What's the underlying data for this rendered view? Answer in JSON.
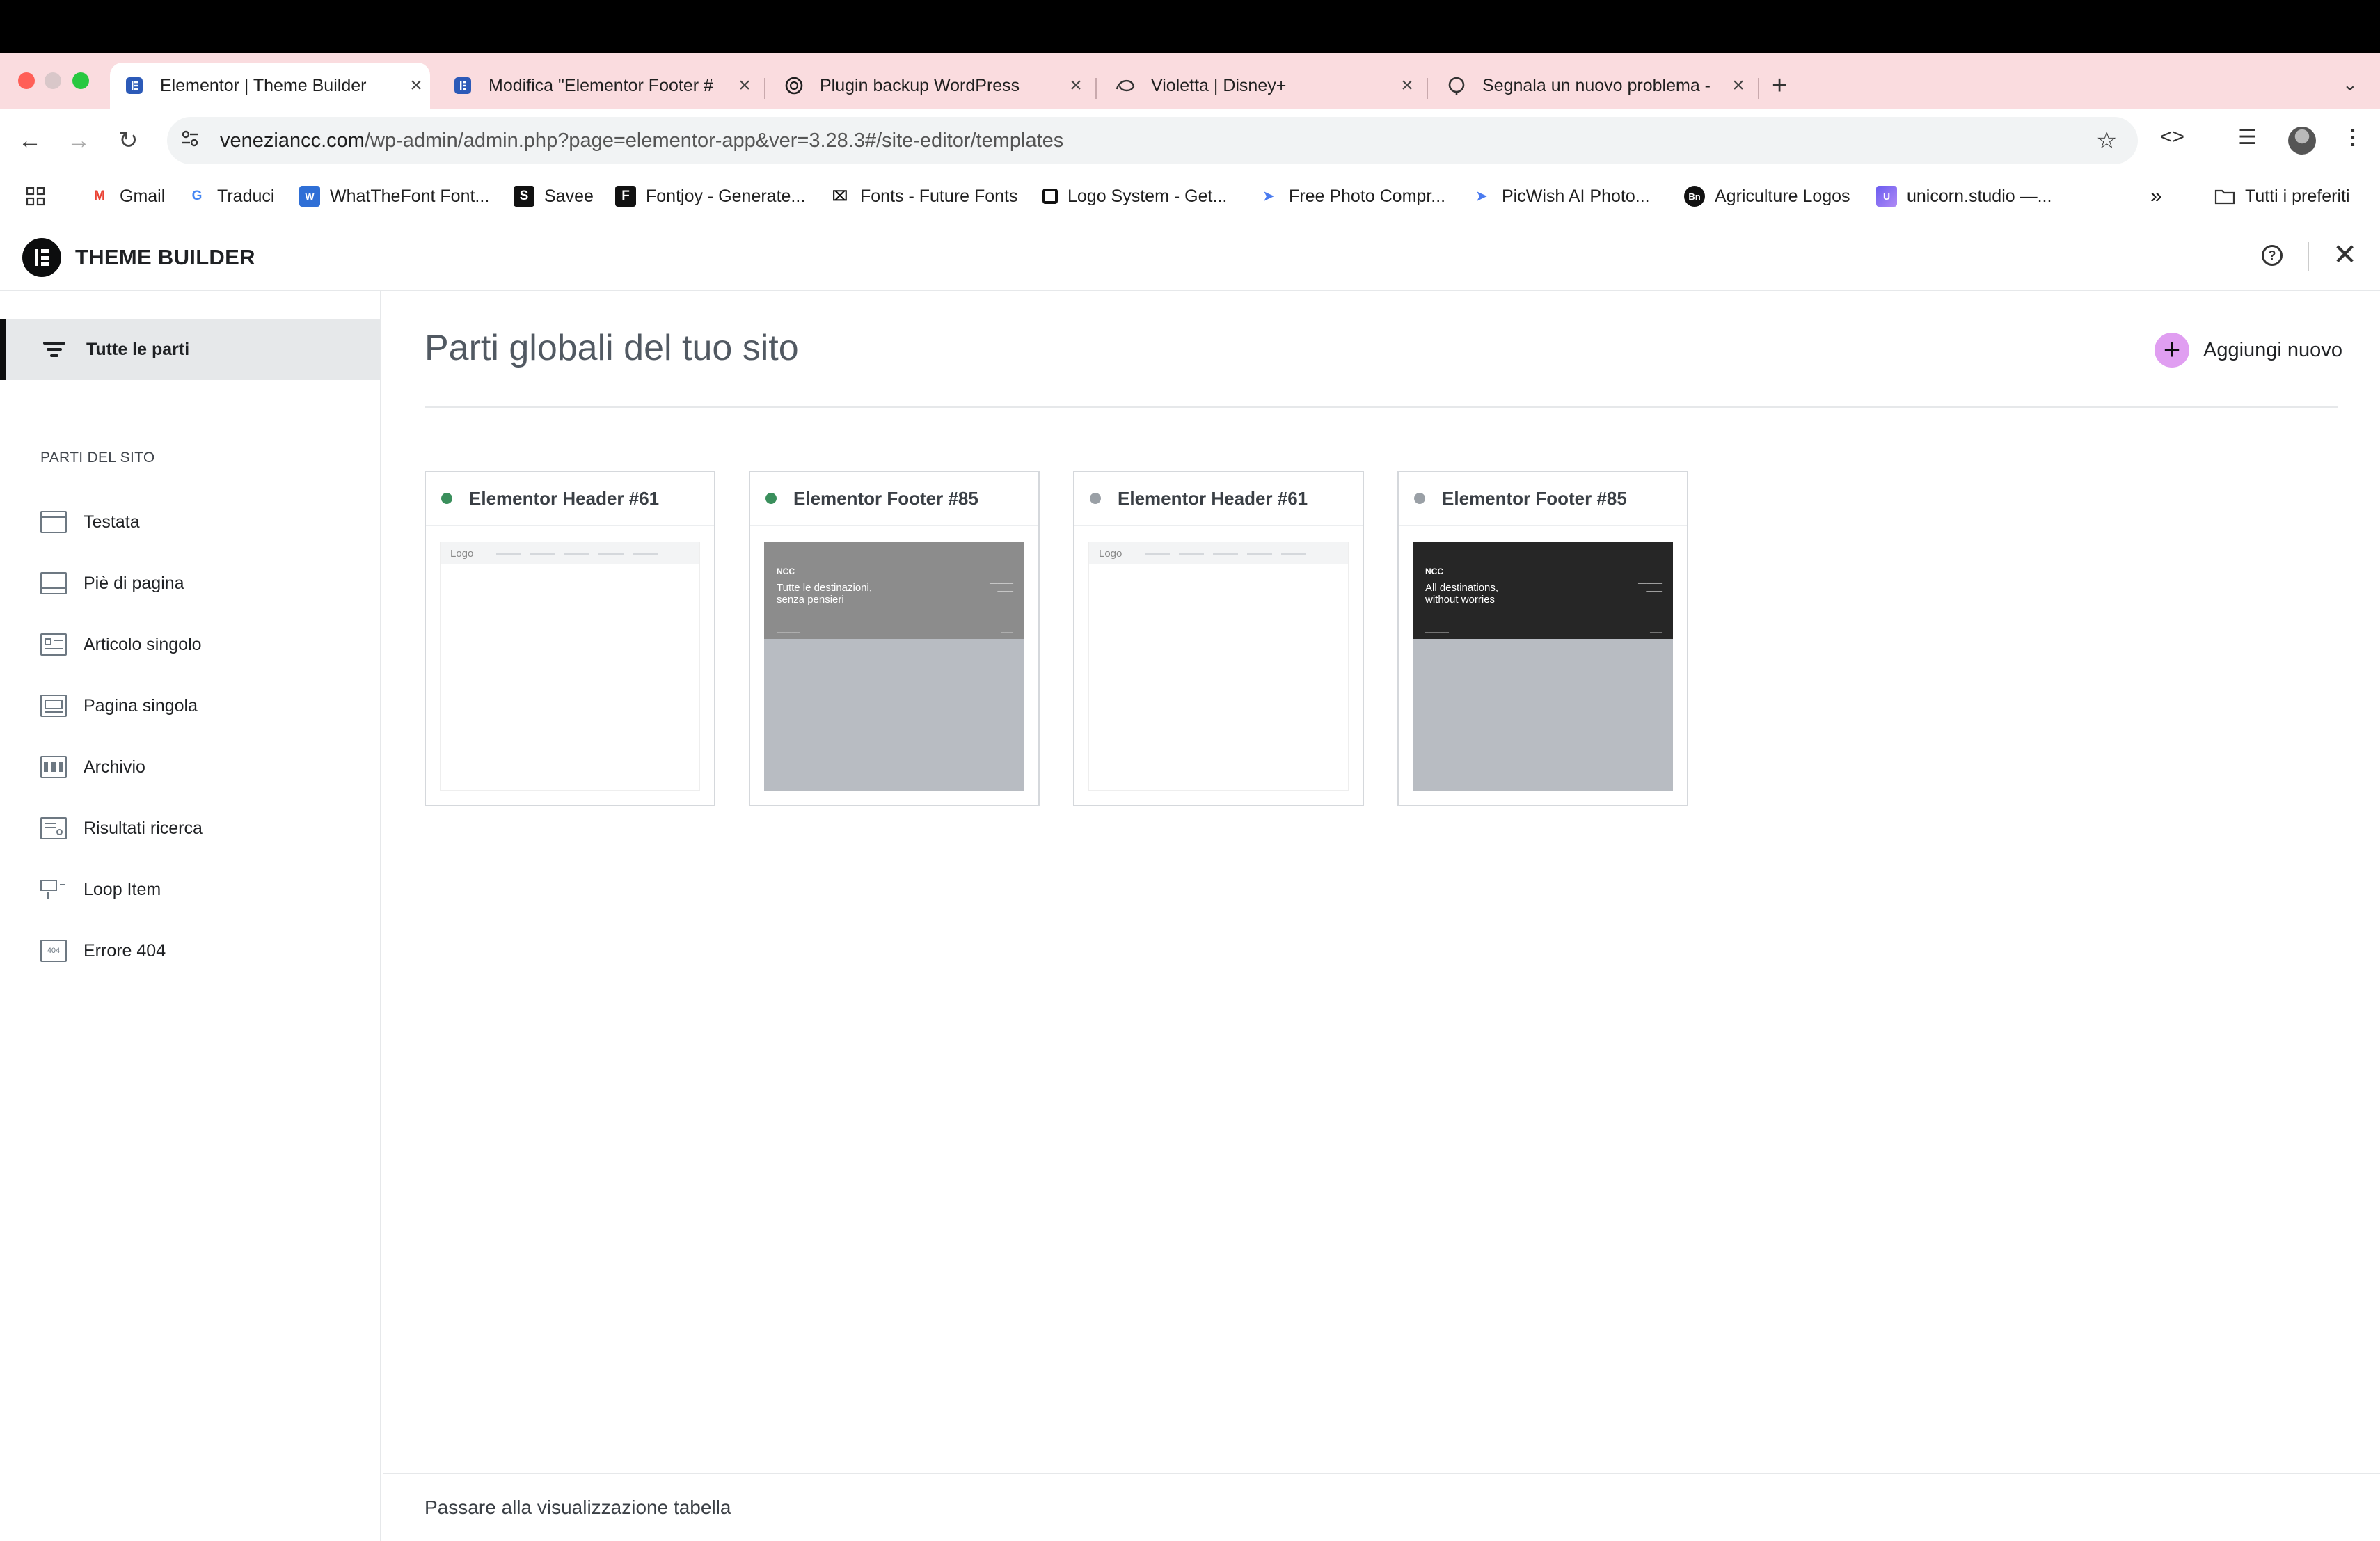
{
  "browser": {
    "tabs": [
      {
        "title": "Elementor | Theme Builder",
        "active": true,
        "icon": "elementor-icon"
      },
      {
        "title": "Modifica \"Elementor Footer #",
        "active": false,
        "icon": "elementor-icon"
      },
      {
        "title": "Plugin backup WordPress",
        "active": false,
        "icon": "openai-icon"
      },
      {
        "title": "Violetta | Disney+",
        "active": false,
        "icon": "disney-plus-icon"
      },
      {
        "title": "Segnala un nuovo problema -",
        "active": false,
        "icon": "support-icon"
      }
    ],
    "close_glyph": "×",
    "url_domain": "veneziancc.com",
    "url_path": "/wp-admin/admin.php?page=elementor-app&ver=3.28.3#/site-editor/templates",
    "bookmarks": [
      {
        "label": "Gmail",
        "icon": "gmail-icon"
      },
      {
        "label": "Traduci",
        "icon": "translate-icon"
      },
      {
        "label": "WhatTheFont Font...",
        "icon": "whatthefont-icon"
      },
      {
        "label": "Savee",
        "icon": "savee-icon"
      },
      {
        "label": "Fontjoy - Generate...",
        "icon": "fontjoy-icon"
      },
      {
        "label": "Fonts - Future Fonts",
        "icon": "futurefonts-icon"
      },
      {
        "label": "Logo System - Get...",
        "icon": "logosystem-icon"
      },
      {
        "label": "Free Photo Compr...",
        "icon": "photo-compressor-icon"
      },
      {
        "label": "PicWish AI Photo...",
        "icon": "picwish-icon"
      },
      {
        "label": "Agriculture Logos",
        "icon": "agriculture-logos-icon"
      },
      {
        "label": "unicorn.studio —...",
        "icon": "unicorn-studio-icon"
      }
    ],
    "bookmarks_overflow": "»",
    "all_bookmarks": "Tutti i preferiti"
  },
  "app": {
    "title": "THEME BUILDER"
  },
  "sidebar": {
    "all_parts": "Tutte le parti",
    "heading": "PARTI DEL SITO",
    "items": [
      {
        "label": "Testata",
        "icon": "header-layout-icon"
      },
      {
        "label": "Piè di pagina",
        "icon": "footer-layout-icon"
      },
      {
        "label": "Articolo singolo",
        "icon": "single-post-icon"
      },
      {
        "label": "Pagina singola",
        "icon": "single-page-icon"
      },
      {
        "label": "Archivio",
        "icon": "archive-icon"
      },
      {
        "label": "Risultati ricerca",
        "icon": "search-results-icon"
      },
      {
        "label": "Loop Item",
        "icon": "loop-item-icon"
      },
      {
        "label": "Errore 404",
        "icon": "error-404-icon"
      }
    ]
  },
  "main": {
    "title": "Parti globali del tuo sito",
    "add_new": "Aggiungi nuovo",
    "cards": [
      {
        "title": "Elementor Header #61",
        "status": "active",
        "kind": "header",
        "thumb_logo": "Logo"
      },
      {
        "title": "Elementor Footer #85",
        "status": "active",
        "kind": "footer",
        "thumb_badge": "NCC",
        "thumb_tagline_1": "Tutte le destinazioni,",
        "thumb_tagline_2": "senza pensieri",
        "thumb_bg": "#8c8c8c"
      },
      {
        "title": "Elementor Header #61",
        "status": "inactive",
        "kind": "header",
        "thumb_logo": "Logo"
      },
      {
        "title": "Elementor Footer #85",
        "status": "inactive",
        "kind": "footer",
        "thumb_badge": "NCC",
        "thumb_tagline_1": "All destinations,",
        "thumb_tagline_2": "without worries",
        "thumb_bg": "#262626"
      }
    ],
    "switch_view": "Passare alla visualizzazione tabella"
  },
  "colors": {
    "active_dot": "#3a8f5c",
    "inactive_dot": "#9aa0a6",
    "accent": "#e09ef1",
    "tabstrip": "#fadcdf"
  }
}
